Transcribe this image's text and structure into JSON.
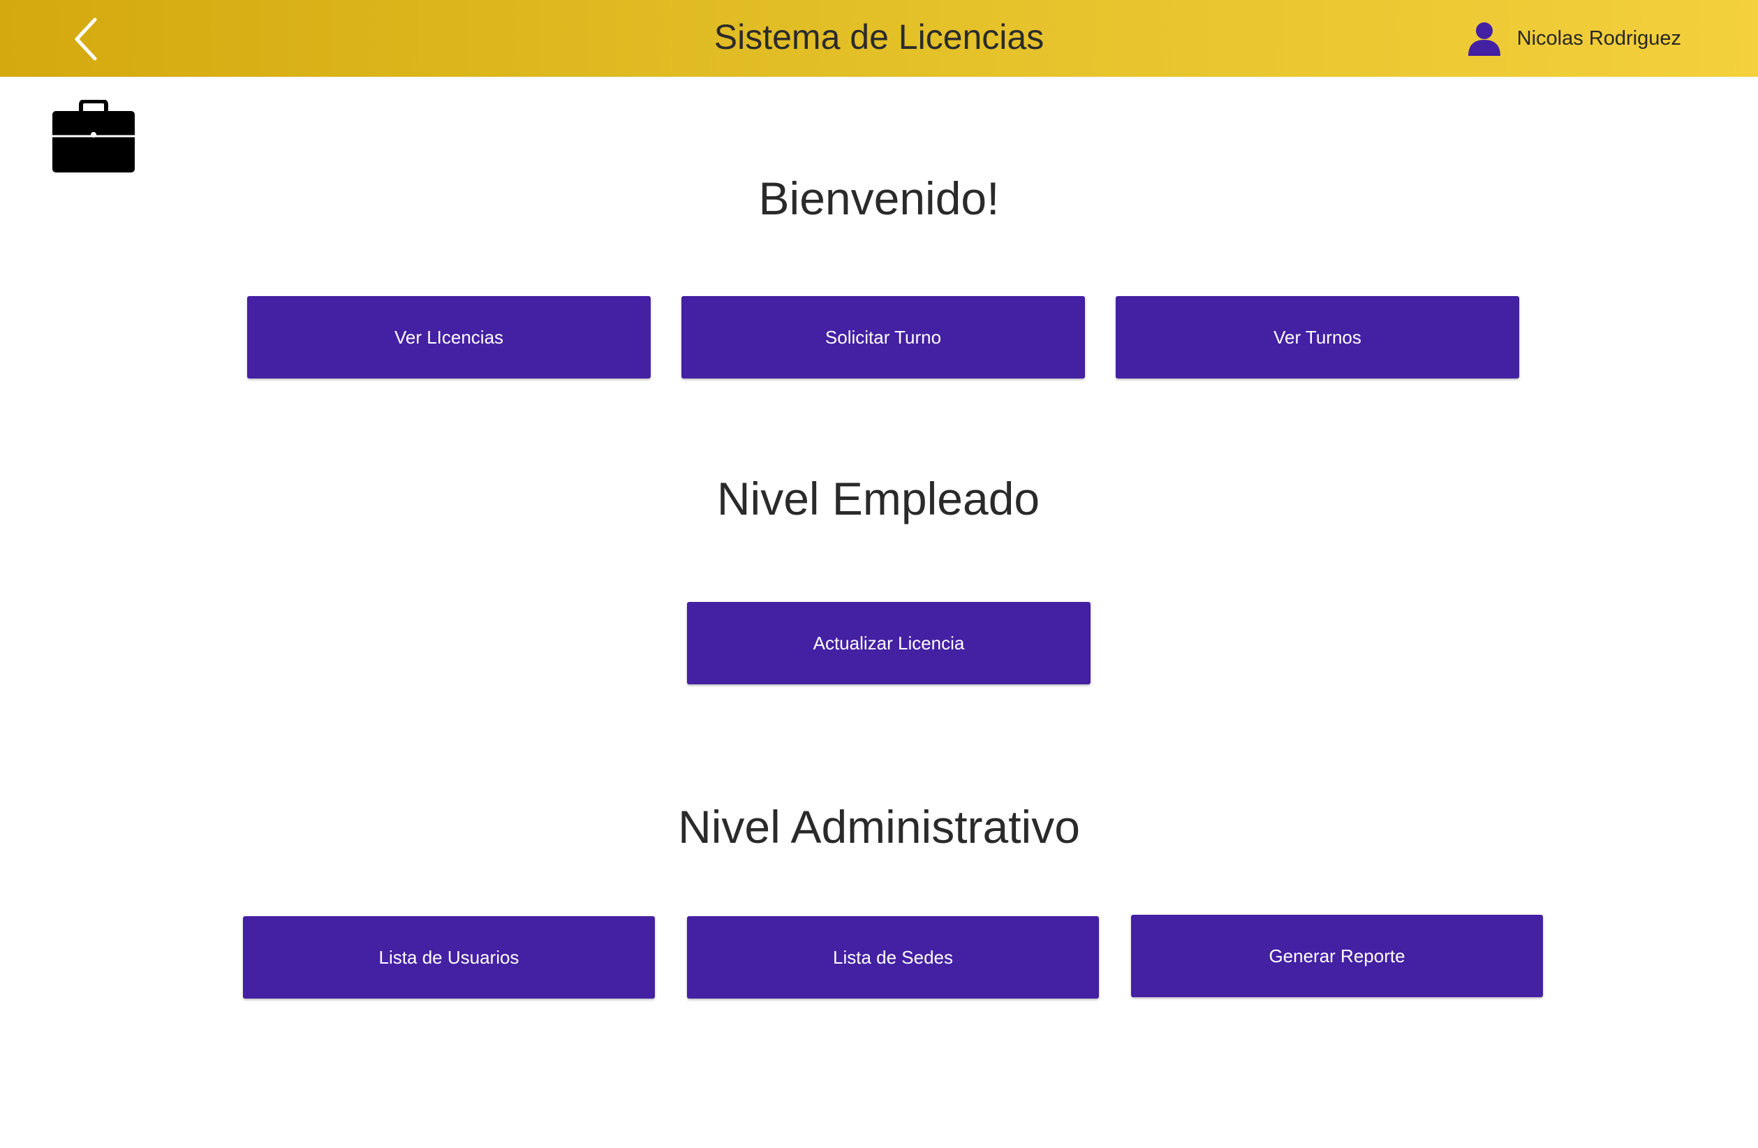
{
  "header": {
    "title": "Sistema de Licencias",
    "user_name": "Nicolas Rodriguez",
    "back_icon": "chevron-left-icon",
    "user_icon": "user-icon"
  },
  "sections": {
    "welcome": {
      "heading": "Bienvenido!",
      "buttons": [
        "Ver LIcencias",
        "Solicitar Turno",
        "Ver Turnos"
      ]
    },
    "employee": {
      "heading": "Nivel Empleado",
      "buttons": [
        "Actualizar Licencia"
      ]
    },
    "admin": {
      "heading": "Nivel Administrativo",
      "buttons": [
        "Lista de Usuarios",
        "Lista de Sedes",
        "Generar Reporte"
      ]
    }
  },
  "icons": {
    "corner_icon": "briefcase-icon"
  },
  "colors": {
    "header_gradient_start": "#d4a90f",
    "header_gradient_end": "#f3d03c",
    "button_background": "#4420a3",
    "button_text": "#ffffff",
    "user_icon": "#4420a3"
  }
}
